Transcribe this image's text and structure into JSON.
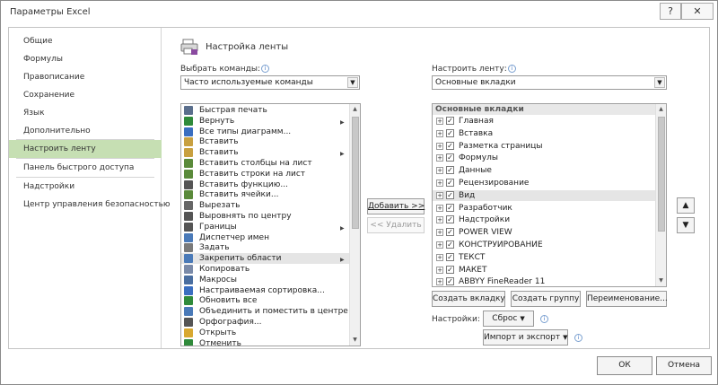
{
  "window": {
    "title": "Параметры Excel",
    "help_glyph": "?",
    "close_glyph": "✕"
  },
  "nav": {
    "items": [
      {
        "label": "Общие"
      },
      {
        "label": "Формулы"
      },
      {
        "label": "Правописание"
      },
      {
        "label": "Сохранение"
      },
      {
        "label": "Язык"
      },
      {
        "label": "Дополнительно"
      },
      {
        "label": "Настроить ленту",
        "selected": true
      },
      {
        "label": "Панель быстрого доступа"
      },
      {
        "label": "Надстройки"
      },
      {
        "label": "Центр управления безопасностью"
      }
    ]
  },
  "panel": {
    "title": "Настройка ленты",
    "choose_label": "Выбрать команды:",
    "choose_value": "Часто используемые команды",
    "customize_label": "Настроить ленту:",
    "customize_value": "Основные вкладки",
    "info_glyph": "i",
    "combo_arrow": "▼"
  },
  "commands": [
    {
      "label": "Быстрая печать",
      "icon": "print-icon",
      "color": "#5a6e8c"
    },
    {
      "label": "Вернуть",
      "icon": "redo-icon",
      "color": "#2f8a3a",
      "submenu": true
    },
    {
      "label": "Все типы диаграмм...",
      "icon": "chart-icon",
      "color": "#3a6ec0"
    },
    {
      "label": "Вставить",
      "icon": "paste-icon",
      "color": "#c8a040"
    },
    {
      "label": "Вставить",
      "icon": "paste-icon",
      "color": "#c8a040",
      "submenu": true
    },
    {
      "label": "Вставить столбцы на лист",
      "icon": "insert-columns-icon",
      "color": "#5a8a3a"
    },
    {
      "label": "Вставить строки на лист",
      "icon": "insert-rows-icon",
      "color": "#5a8a3a"
    },
    {
      "label": "Вставить функцию...",
      "icon": "function-icon",
      "color": "#555555"
    },
    {
      "label": "Вставить ячейки...",
      "icon": "insert-cells-icon",
      "color": "#5a8a3a"
    },
    {
      "label": "Вырезать",
      "icon": "cut-icon",
      "color": "#666666"
    },
    {
      "label": "Выровнять по центру",
      "icon": "align-center-icon",
      "color": "#555555"
    },
    {
      "label": "Границы",
      "icon": "borders-icon",
      "color": "#555555",
      "submenu": true
    },
    {
      "label": "Диспетчер имен",
      "icon": "name-manager-icon",
      "color": "#4a7ab8"
    },
    {
      "label": "Задать",
      "icon": "set-area-icon",
      "color": "#7a7a7a"
    },
    {
      "label": "Закрепить области",
      "icon": "freeze-panes-icon",
      "color": "#4a7ab8",
      "submenu": true,
      "highlighted": true
    },
    {
      "label": "Копировать",
      "icon": "copy-icon",
      "color": "#7a8aa8"
    },
    {
      "label": "Макросы",
      "icon": "macros-icon",
      "color": "#4a6ea0"
    },
    {
      "label": "Настраиваемая сортировка...",
      "icon": "sort-icon",
      "color": "#3a6ec0"
    },
    {
      "label": "Обновить все",
      "icon": "refresh-icon",
      "color": "#2f8a3a"
    },
    {
      "label": "Объединить и поместить в центре",
      "icon": "merge-icon",
      "color": "#4a7ab8"
    },
    {
      "label": "Орфография...",
      "icon": "spelling-icon",
      "color": "#555555"
    },
    {
      "label": "Открыть",
      "icon": "open-folder-icon",
      "color": "#d8a830"
    },
    {
      "label": "Отменить",
      "icon": "undo-icon",
      "color": "#2f8a3a"
    }
  ],
  "submenu_glyph": "▶",
  "ribbon_tree": {
    "header": "Основные вкладки",
    "expand_glyph": "+",
    "check_glyph": "✓",
    "items": [
      {
        "label": "Главная"
      },
      {
        "label": "Вставка"
      },
      {
        "label": "Разметка страницы"
      },
      {
        "label": "Формулы"
      },
      {
        "label": "Данные"
      },
      {
        "label": "Рецензирование"
      },
      {
        "label": "Вид",
        "highlighted": true
      },
      {
        "label": "Разработчик"
      },
      {
        "label": "Надстройки"
      },
      {
        "label": "POWER VIEW"
      },
      {
        "label": "КОНСТРУИРОВАНИЕ"
      },
      {
        "label": "ТЕКСТ"
      },
      {
        "label": "МАКЕТ"
      },
      {
        "label": "ABBYY FineReader 11"
      }
    ]
  },
  "scroll": {
    "up": "▲",
    "down": "▼"
  },
  "buttons": {
    "add": "Добавить >>",
    "remove": "<< Удалить",
    "new_tab": "Создать вкладку",
    "new_group": "Создать группу",
    "rename": "Переименование...",
    "settings_label": "Настройки:",
    "reset": "Сброс",
    "import_export": "Импорт и экспорт",
    "move_up": "▲",
    "move_down": "▼",
    "dropdown_glyph": "▼",
    "ok": "ОК",
    "cancel": "Отмена"
  }
}
